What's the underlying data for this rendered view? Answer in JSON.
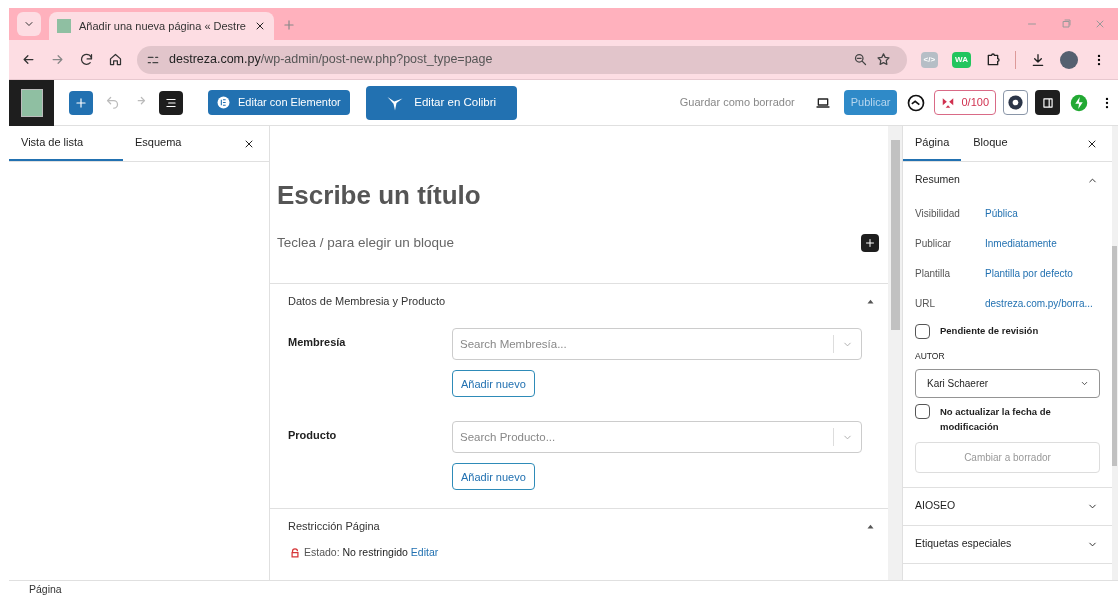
{
  "browser": {
    "tab_title": "Añadir una nueva página « Destre",
    "url_host": "destreza.com.py",
    "url_path": "/wp-admin/post-new.php?post_type=page",
    "extensions": [
      {
        "label": "</>",
        "color": "#b6bec6"
      },
      {
        "label": "WA",
        "color": "#22c55e"
      }
    ]
  },
  "toolbar": {
    "elementor_button": "Editar con Elementor",
    "colibri_button": "Editar en Colibri",
    "save_draft": "Guardar como borrador",
    "publish": "Publicar",
    "seo_score": "0/100"
  },
  "left_panel": {
    "tabs": [
      {
        "label": "Vista de lista",
        "selected": true
      },
      {
        "label": "Esquema",
        "selected": false
      }
    ]
  },
  "editor": {
    "title_placeholder": "Escribe un título",
    "block_placeholder": "Teclea / para elegir un bloque",
    "meta_boxes": [
      {
        "title": "Datos de Membresia y Producto",
        "expanded": true,
        "fields": [
          {
            "label": "Membresía",
            "placeholder": "Search Membresía...",
            "add_button": "Añadir nuevo"
          },
          {
            "label": "Producto",
            "placeholder": "Search Producto...",
            "add_button": "Añadir nuevo"
          }
        ]
      },
      {
        "title": "Restricción Página",
        "expanded": true,
        "status_label": "Estado:",
        "status_value": "No restringido",
        "status_link": "Editar"
      }
    ]
  },
  "sidebar": {
    "tabs": [
      {
        "label": "Página",
        "selected": true
      },
      {
        "label": "Bloque",
        "selected": false
      }
    ],
    "summary": {
      "title": "Resumen",
      "expanded": true,
      "rows": [
        {
          "label": "Visibilidad",
          "value": "Pública"
        },
        {
          "label": "Publicar",
          "value": "Inmediatamente"
        },
        {
          "label": "Plantilla",
          "value": "Plantilla por defecto"
        },
        {
          "label": "URL",
          "value": "destreza.com.py/borra..."
        }
      ],
      "pending_review": {
        "label": "Pendiente de revisión",
        "checked": false
      },
      "author_heading": "AUTOR",
      "author": "Kari Schaerer",
      "no_update_date": {
        "label": "No actualizar la fecha de modificación",
        "checked": false
      },
      "draft_button": "Cambiar a borrador"
    },
    "panels": [
      {
        "title": "AIOSEO",
        "expanded": false
      },
      {
        "title": "Etiquetas especiales",
        "expanded": false
      }
    ]
  },
  "status_bar": "Página"
}
